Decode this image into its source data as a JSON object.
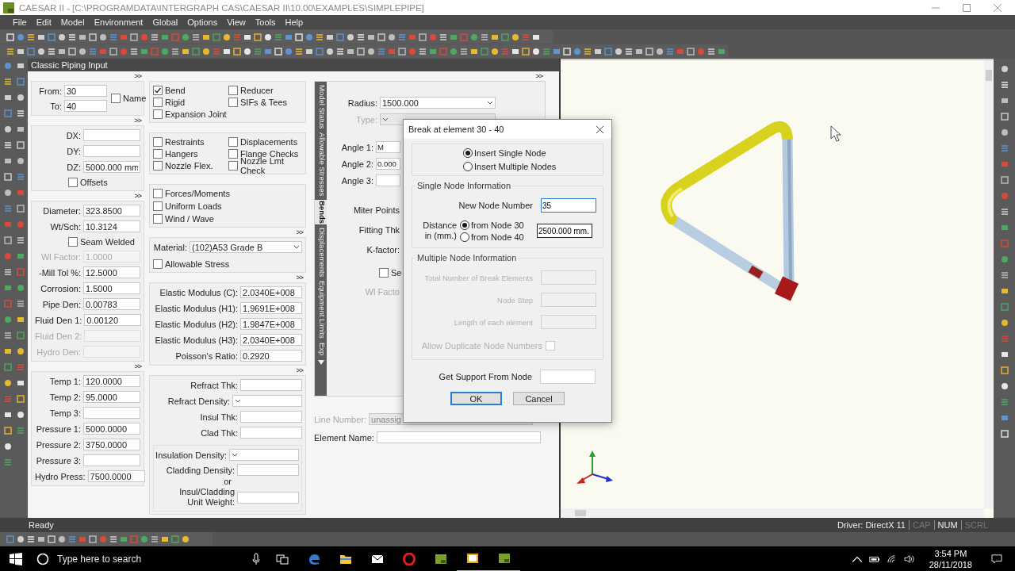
{
  "window": {
    "title": "CAESAR II - [C:\\PROGRAMDATA\\INTERGRAPH CAS\\CAESAR II\\10.00\\EXAMPLES\\SIMPLEPIPE]"
  },
  "menu": [
    "File",
    "Edit",
    "Model",
    "Environment",
    "Global",
    "Options",
    "View",
    "Tools",
    "Help"
  ],
  "panel": {
    "title": "Classic Piping Input"
  },
  "left_column": [
    {
      "kind": "nodes",
      "expander": ">>",
      "items": [
        {
          "kind": "field",
          "label": "From:",
          "value": "30"
        },
        {
          "kind": "field",
          "label": "To:",
          "value": "40"
        },
        {
          "kind": "checkbox",
          "label": "Name",
          "checked": false
        }
      ]
    },
    {
      "kind": "stack",
      "expander": ">>",
      "items": [
        {
          "kind": "field",
          "label": "DX:"
        },
        {
          "kind": "field",
          "label": "DY:"
        },
        {
          "kind": "field",
          "label": "DZ:",
          "value": "5000.000 mm"
        },
        {
          "kind": "checkbox",
          "label": "Offsets",
          "checked": false
        }
      ]
    },
    {
      "kind": "stack",
      "expander": ">>",
      "items": [
        {
          "kind": "field",
          "label": "Diameter:",
          "value": "323.8500",
          "disabled": false
        },
        {
          "kind": "field",
          "label": "Wt/Sch:",
          "value": "10.3124",
          "disabled": false
        },
        {
          "kind": "checkbox",
          "label": "Seam Welded",
          "checked": false
        },
        {
          "kind": "field",
          "label": "Wl Factor:",
          "value": "1.0000",
          "disabled": true
        },
        {
          "kind": "field",
          "label": "-Mill Tol %:",
          "value": "12.5000",
          "disabled": false
        },
        {
          "kind": "field",
          "label": "Corrosion:",
          "value": "1.5000",
          "disabled": false
        },
        {
          "kind": "field",
          "label": "Pipe Den:",
          "value": "0.00783",
          "disabled": false
        },
        {
          "kind": "field",
          "label": "Fluid Den 1:",
          "value": "0.00120",
          "disabled": false
        },
        {
          "kind": "field",
          "label": "Fluid Den 2:",
          "disabled": true
        },
        {
          "kind": "field",
          "label": "Hydro Den:",
          "disabled": true
        }
      ]
    },
    {
      "kind": "stack",
      "expander": ">>",
      "items": [
        {
          "kind": "field",
          "label": "Temp 1:",
          "value": "120.0000"
        },
        {
          "kind": "field",
          "label": "Temp 2:",
          "value": "95.0000"
        },
        {
          "kind": "field",
          "label": "Temp 3:"
        },
        {
          "kind": "field",
          "label": "Pressure 1:",
          "value": "5000.0000"
        },
        {
          "kind": "field",
          "label": "Pressure 2:",
          "value": "3750.0000"
        },
        {
          "kind": "field",
          "label": "Pressure 3:"
        },
        {
          "kind": "field",
          "label": "Hydro Press:",
          "value": "7500.0000"
        }
      ]
    }
  ],
  "middle_column": [
    {
      "kind": "check-grid",
      "items": [
        {
          "kind": "checkbox",
          "label": "Bend",
          "checked": true
        },
        {
          "kind": "checkbox",
          "label": "Reducer",
          "checked": false
        },
        {
          "kind": "checkbox",
          "label": "Rigid",
          "checked": false
        },
        {
          "kind": "checkbox",
          "label": "SIFs & Tees",
          "checked": false
        },
        {
          "kind": "checkbox",
          "label": "Expansion Joint",
          "checked": false
        }
      ]
    },
    {
      "kind": "check-grid",
      "items": [
        {
          "kind": "checkbox",
          "label": "Restraints",
          "checked": false
        },
        {
          "kind": "checkbox",
          "label": "Displacements",
          "checked": false
        },
        {
          "kind": "checkbox",
          "label": "Hangers",
          "checked": false
        },
        {
          "kind": "checkbox",
          "label": "Flange Checks",
          "checked": false
        },
        {
          "kind": "checkbox",
          "label": "Nozzle Flex.",
          "checked": false
        },
        {
          "kind": "checkbox",
          "label": "Nozzle Lmt Check",
          "checked": false
        }
      ]
    },
    {
      "kind": "check-list",
      "items": [
        {
          "kind": "checkbox",
          "label": "Forces/Moments",
          "checked": false
        },
        {
          "kind": "checkbox",
          "label": "Uniform Loads",
          "checked": false
        },
        {
          "kind": "checkbox",
          "label": "Wind / Wave",
          "checked": false
        }
      ]
    },
    {
      "kind": "material",
      "expander": ">>",
      "items": [
        {
          "kind": "dropdown",
          "label": "Material:",
          "value": "(102)A53 Grade B"
        },
        {
          "kind": "checkbox",
          "label": "Allowable Stress",
          "checked": false
        }
      ]
    },
    {
      "kind": "stack",
      "expander": ">>",
      "items": [
        {
          "kind": "field",
          "label": "Elastic Modulus (C):",
          "value": "2.0340E+008"
        },
        {
          "kind": "field",
          "label": "Elastic Modulus (H1):",
          "value": "1.9691E+008"
        },
        {
          "kind": "field",
          "label": "Elastic Modulus (H2):",
          "value": "1.9847E+008"
        },
        {
          "kind": "field",
          "label": "Elastic Modulus (H3):",
          "value": "2.0340E+008"
        },
        {
          "kind": "field",
          "label": "Poisson's Ratio:",
          "value": "0.2920"
        }
      ]
    },
    {
      "kind": "stack",
      "expander": ">>",
      "items": [
        {
          "kind": "field",
          "label": "Refract Thk:"
        },
        {
          "kind": "dropdown",
          "label": "Refract Density:"
        },
        {
          "kind": "field",
          "label": "Insul Thk:"
        },
        {
          "kind": "field",
          "label": "Clad Thk:"
        },
        {
          "kind": "group",
          "items": [
            {
              "kind": "dropdown",
              "label": "Insulation Density:"
            },
            {
              "kind": "field",
              "label": "Cladding Density:"
            },
            {
              "kind": "note",
              "label": "or"
            },
            {
              "kind": "field",
              "label": "Insul/Cladding Unit Weight:"
            }
          ]
        }
      ]
    }
  ],
  "tabs": [
    {
      "label": "Model Status",
      "selected": false
    },
    {
      "label": "Allowable Stresses",
      "selected": false
    },
    {
      "label": "Bends",
      "selected": true
    },
    {
      "label": "Displacements",
      "selected": false
    },
    {
      "label": "Equipment Limits",
      "selected": false
    },
    {
      "label": "Exp",
      "selected": false
    }
  ],
  "bends": {
    "expander": ">>",
    "items": [
      {
        "kind": "dropdown",
        "label": "Radius:",
        "value": "1500.000",
        "disabled": false
      },
      {
        "kind": "dropdown",
        "label": "Type:",
        "disabled": true
      },
      {
        "kind": "field",
        "label": "Angle 1:",
        "value": "M",
        "disabled": false
      },
      {
        "kind": "field",
        "label": "Angle 2:",
        "value": "0.000",
        "disabled": false
      },
      {
        "kind": "field",
        "label": "Angle 3:",
        "disabled": false
      },
      {
        "kind": "label",
        "label": "Miter Points",
        "disabled": false
      },
      {
        "kind": "label",
        "label": "Fitting Thk",
        "disabled": false
      },
      {
        "kind": "label",
        "label": "K-factor:",
        "disabled": false
      },
      {
        "kind": "checkbox",
        "label": "Se",
        "checked": false
      },
      {
        "kind": "label",
        "label": "Wl Facto",
        "disabled": true
      }
    ]
  },
  "line_fields": [
    {
      "kind": "dropdown",
      "label": "Line Number:",
      "value": "unassig",
      "disabled": true
    },
    {
      "kind": "field",
      "label": "Element Name:",
      "disabled": false
    }
  ],
  "dialog": {
    "title": "Break at element 30 - 40",
    "modes": [
      {
        "label": "Insert Single Node",
        "selected": true
      },
      {
        "label": "Insert Multiple Nodes",
        "selected": false
      }
    ],
    "single": {
      "title": "Single Node Information",
      "node_label": "New Node Number",
      "node_value": "35",
      "distance_label": "Distance  in (mm.)",
      "from": [
        {
          "label": "from Node 30",
          "selected": true
        },
        {
          "label": "from Node 40",
          "selected": false
        }
      ],
      "distance_value": "2500.000 mm."
    },
    "multiple": {
      "title": "Multiple Node Information",
      "disabled": true,
      "fields": [
        {
          "label": "Total Number of Break Elements"
        },
        {
          "label": "Node Step"
        },
        {
          "label": "Length of each element"
        }
      ],
      "duplicate": {
        "label": "Allow Duplicate Node Numbers",
        "checked": false
      }
    },
    "support": {
      "label": "Get Support From Node"
    },
    "buttons": [
      {
        "label": "OK",
        "default": true
      },
      {
        "label": "Cancel",
        "default": false
      }
    ]
  },
  "status": {
    "text": "Ready",
    "driver": "Driver: DirectX 11",
    "indicators": [
      {
        "label": "CAP",
        "on": false
      },
      {
        "label": "NUM",
        "on": true
      },
      {
        "label": "SCRL",
        "on": false
      }
    ]
  },
  "taskbar": {
    "search_placeholder": "Type here to search",
    "time": "3:54 PM",
    "date": "28/11/2018"
  }
}
